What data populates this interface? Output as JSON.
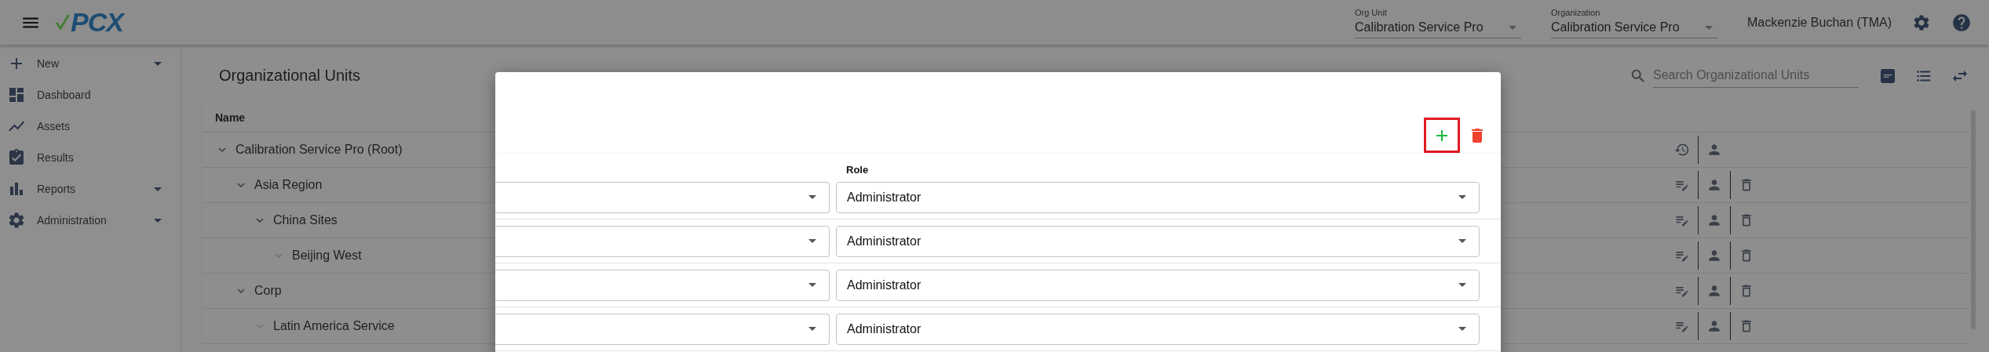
{
  "header": {
    "logo": "PCX",
    "selects": [
      {
        "label": "Org Unit",
        "value": "Calibration Service Pro"
      },
      {
        "label": "Organization",
        "value": "Calibration Service Pro"
      }
    ],
    "user": "Mackenzie Buchan (TMA)"
  },
  "sidebar": {
    "items": [
      {
        "kind": "menu",
        "label": "New"
      },
      {
        "kind": "link",
        "label": "Dashboard"
      },
      {
        "kind": "link",
        "label": "Assets"
      },
      {
        "kind": "link",
        "label": "Results"
      },
      {
        "kind": "menu",
        "label": "Reports"
      },
      {
        "kind": "menu",
        "label": "Administration"
      }
    ]
  },
  "page": {
    "title": "Organizational Units",
    "search": {
      "placeholder": "Search Organizational Units"
    },
    "table": {
      "columns": [
        "Name"
      ],
      "rows": [
        {
          "name": "Calibration Service Pro (Root)",
          "kind": "root",
          "expanded": true,
          "children": [
            {
              "name": "Asia Region",
              "kind": "unit",
              "expanded": true,
              "children": [
                {
                  "name": "China Sites",
                  "kind": "unit",
                  "expanded": true,
                  "children": [
                    {
                      "name": "Beijing West",
                      "kind": "unit",
                      "expanded": false
                    }
                  ]
                }
              ]
            },
            {
              "name": "Corp",
              "kind": "unit",
              "expanded": true,
              "children": [
                {
                  "name": "Latin America Service",
                  "kind": "unit",
                  "expanded": false
                }
              ]
            }
          ]
        }
      ]
    }
  },
  "dialog": {
    "column_2": "Role",
    "rows": [
      {
        "role": "Administrator"
      },
      {
        "role": "Administrator"
      },
      {
        "role": "Administrator"
      },
      {
        "role": "Administrator"
      }
    ]
  }
}
